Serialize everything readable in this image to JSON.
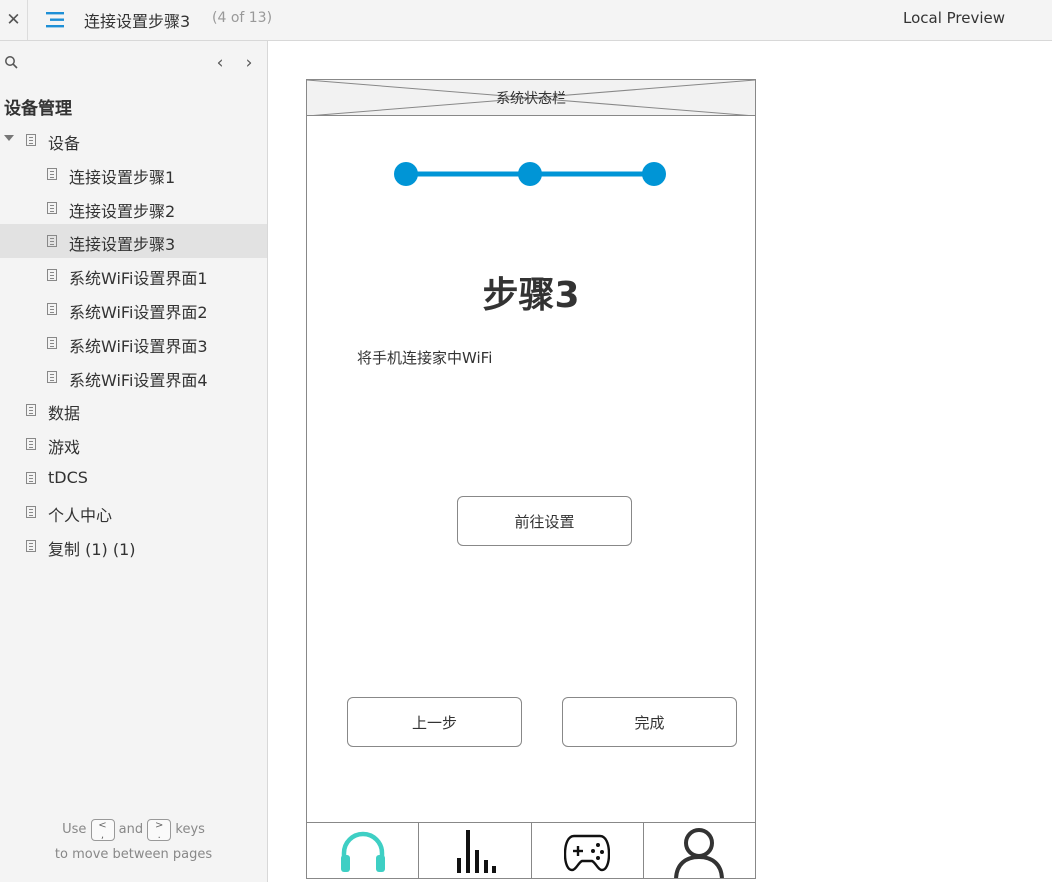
{
  "topbar": {
    "close_glyph": "✕",
    "title": "连接设置步骤3",
    "page_count": "(4 of 13)",
    "local_preview": "Local Preview"
  },
  "sidebar": {
    "prev_glyph": "‹",
    "next_glyph": "›",
    "section_title": "设备管理",
    "items": [
      {
        "label": "设备",
        "level": 0,
        "expanded": true
      },
      {
        "label": "连接设置步骤1",
        "level": 1
      },
      {
        "label": "连接设置步骤2",
        "level": 1
      },
      {
        "label": "连接设置步骤3",
        "level": 1,
        "selected": true
      },
      {
        "label": "系统WiFi设置界面1",
        "level": 1
      },
      {
        "label": "系统WiFi设置界面2",
        "level": 1
      },
      {
        "label": "系统WiFi设置界面3",
        "level": 1
      },
      {
        "label": "系统WiFi设置界面4",
        "level": 1
      },
      {
        "label": "数据",
        "level": 0
      },
      {
        "label": "游戏",
        "level": 0
      },
      {
        "label": "tDCS",
        "level": 0
      },
      {
        "label": "个人中心",
        "level": 0
      },
      {
        "label": "复制 (1) (1)",
        "level": 0
      }
    ],
    "hint": {
      "use": "Use",
      "prev_key": "<\n,",
      "and": "and",
      "next_key": ">\n.",
      "keys": "keys",
      "line2": "to move between pages"
    }
  },
  "phone": {
    "statusbar": "系统状态栏",
    "step_title": "步骤3",
    "step_desc": "将手机连接家中WiFi",
    "goto_button": "前往设置",
    "prev_button": "上一步",
    "done_button": "完成",
    "progress": {
      "total_steps": 3,
      "current_step": 3,
      "color": "#0095d6"
    },
    "tabs": [
      {
        "icon": "headphones-icon",
        "color": "#3ecfc4"
      },
      {
        "icon": "bar-chart-icon",
        "color": "#111111"
      },
      {
        "icon": "gamepad-icon",
        "color": "#111111"
      },
      {
        "icon": "user-icon",
        "color": "#333333"
      }
    ]
  }
}
